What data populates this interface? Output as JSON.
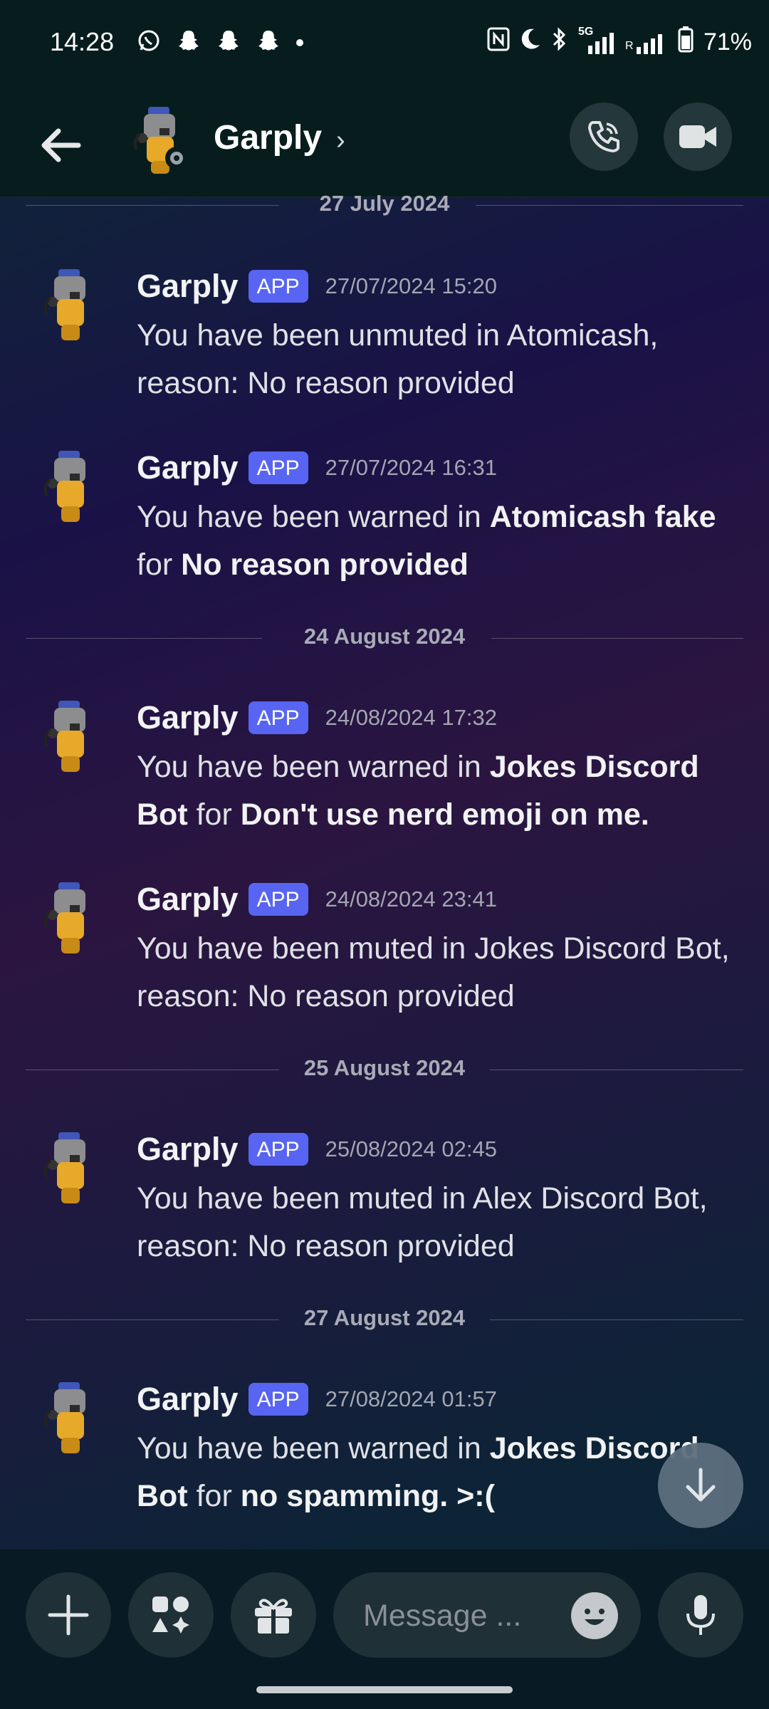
{
  "status_bar": {
    "time": "14:28",
    "battery": "71%",
    "left_icons": [
      "whatsapp-icon",
      "snapchat-icon",
      "snapchat-icon",
      "snapchat-icon",
      "dot-icon"
    ],
    "right_icons": [
      "nfc-icon",
      "moon-icon",
      "bluetooth-icon",
      "5g-signal-icon",
      "signal-icon",
      "battery-icon"
    ],
    "network": "5G",
    "roaming": "R"
  },
  "header": {
    "name": "Garply",
    "chevron": "›"
  },
  "dividers": [
    "27 July 2024",
    "24 August 2024",
    "25 August 2024",
    "27 August 2024"
  ],
  "messages": [
    {
      "author": "Garply",
      "tag": "APP",
      "time": "27/07/2024 15:20",
      "parts": [
        {
          "t": "You have been unmuted in Atomicash, reason: No reason provided",
          "b": false
        }
      ]
    },
    {
      "author": "Garply",
      "tag": "APP",
      "time": "27/07/2024 16:31",
      "parts": [
        {
          "t": "You have been warned in ",
          "b": false
        },
        {
          "t": "Atomicash fake",
          "b": true
        },
        {
          "t": " for ",
          "b": false
        },
        {
          "t": "No reason provided",
          "b": true
        }
      ]
    },
    {
      "author": "Garply",
      "tag": "APP",
      "time": "24/08/2024 17:32",
      "parts": [
        {
          "t": "You have been warned in ",
          "b": false
        },
        {
          "t": "Jokes Discord Bot",
          "b": true
        },
        {
          "t": " for ",
          "b": false
        },
        {
          "t": "Don't use nerd emoji on me.",
          "b": true
        }
      ]
    },
    {
      "author": "Garply",
      "tag": "APP",
      "time": "24/08/2024 23:41",
      "parts": [
        {
          "t": "You have been muted in Jokes Discord Bot, reason: No reason provided",
          "b": false
        }
      ]
    },
    {
      "author": "Garply",
      "tag": "APP",
      "time": "25/08/2024 02:45",
      "parts": [
        {
          "t": "You have been muted in Alex Discord Bot, reason: No reason provided",
          "b": false
        }
      ]
    },
    {
      "author": "Garply",
      "tag": "APP",
      "time": "27/08/2024 01:57",
      "parts": [
        {
          "t": "You have been warned in ",
          "b": false
        },
        {
          "t": "Jokes Discord Bot",
          "b": true
        },
        {
          "t": " for ",
          "b": false
        },
        {
          "t": "no spamming. >:(",
          "b": true
        }
      ]
    }
  ],
  "composer": {
    "placeholder": "Message ..."
  },
  "colors": {
    "app_tag": "#5865f2",
    "bar_bg": "#071d1d"
  }
}
